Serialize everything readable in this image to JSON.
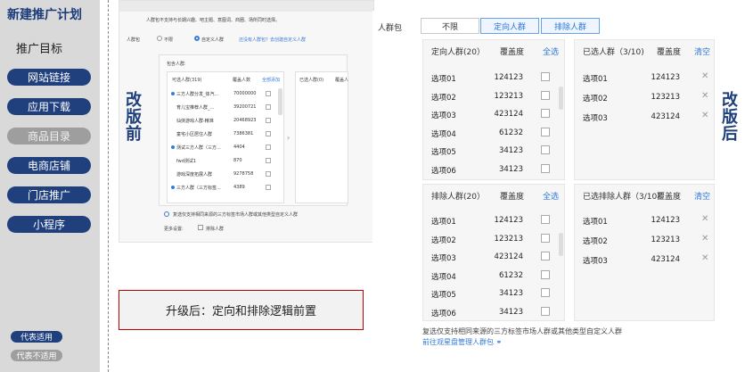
{
  "sidebar": {
    "title": "新建推广计划",
    "subtitle": "推广目标",
    "items": [
      {
        "label": "网站链接",
        "state": "active"
      },
      {
        "label": "应用下载",
        "state": "active"
      },
      {
        "label": "商品目录",
        "state": "disabled"
      },
      {
        "label": "电商店铺",
        "state": "active"
      },
      {
        "label": "门店推广",
        "state": "active"
      },
      {
        "label": "小程序",
        "state": "active"
      }
    ],
    "legend": {
      "applies": "代表适用",
      "not_applies": "代表不适用"
    }
  },
  "labels": {
    "before": "改版前",
    "after": "改版后"
  },
  "upgrade_note": "升级后：定向和排除逻辑前置",
  "before": {
    "notice": "人群包不支持与长期兴趣、吧主题、意图词、商圈、场所同时选择。",
    "field_label": "人群包",
    "radio_unlimited": "不限",
    "radio_custom": "自定义人群",
    "link_text": "还没有人群包？去创建自定义人群",
    "include_label": "包含人群:",
    "available_header": "可选人群(319)",
    "coverage_header": "覆盖人数",
    "add_all": "全部添加",
    "selected_header": "已选人群(0)",
    "selected_coverage": "覆盖人",
    "rows": [
      {
        "name": "三方人群分发_体汽...",
        "value": "70000000"
      },
      {
        "name": "育儿宝推荐人群_...",
        "value": "39200721"
      },
      {
        "name": "仙侠游戏人群-精准",
        "value": "20468923"
      },
      {
        "name": "童宅小区居住人群",
        "value": "7386381"
      },
      {
        "name": "测试三方人群（三方...",
        "value": "4404"
      },
      {
        "name": "fwd测试1",
        "value": "870"
      },
      {
        "name": "游戏深度拓展人群",
        "value": "9278758"
      },
      {
        "name": "三方人群（三方标签...",
        "value": "4389"
      }
    ],
    "bottom_note": "复选仅支持相同来源的三方标签市场人群或其他类型自定义人群",
    "more_settings": "更多设置:",
    "exclude_check": "排除人群"
  },
  "after": {
    "field_label": "人群包",
    "tabs": [
      {
        "label": "不限",
        "selected": false
      },
      {
        "label": "定向人群",
        "selected": true
      },
      {
        "label": "排除人群",
        "selected": true
      }
    ],
    "include_panel": {
      "title": "定向人群(20）",
      "coverage": "覆盖度",
      "action": "全选",
      "rows": [
        {
          "name": "选项01",
          "value": "124123"
        },
        {
          "name": "选项02",
          "value": "123213"
        },
        {
          "name": "选项03",
          "value": "423124"
        },
        {
          "name": "选项04",
          "value": "61232"
        },
        {
          "name": "选项05",
          "value": "34123"
        },
        {
          "name": "选项06",
          "value": "34123"
        }
      ]
    },
    "selected_panel": {
      "title": "已选人群（3/10)",
      "coverage": "覆盖度",
      "action": "清空",
      "rows": [
        {
          "name": "选项01",
          "value": "124123"
        },
        {
          "name": "选项02",
          "value": "123213"
        },
        {
          "name": "选项03",
          "value": "423124"
        }
      ]
    },
    "exclude_panel": {
      "title": "排除人群(20）",
      "coverage": "覆盖度",
      "action": "全选",
      "rows": [
        {
          "name": "选项01",
          "value": "124123"
        },
        {
          "name": "选项02",
          "value": "123213"
        },
        {
          "name": "选项03",
          "value": "423124"
        },
        {
          "name": "选项04",
          "value": "61232"
        },
        {
          "name": "选项05",
          "value": "34123"
        },
        {
          "name": "选项06",
          "value": "34123"
        }
      ]
    },
    "excluded_selected_panel": {
      "title": "已选排除人群（3/10)",
      "coverage": "覆盖度",
      "action": "清空",
      "rows": [
        {
          "name": "选项01",
          "value": "124123"
        },
        {
          "name": "选项02",
          "value": "123213"
        },
        {
          "name": "选项03",
          "value": "423124"
        }
      ]
    },
    "note": "复选仅支持相同来源的三方标签市场人群或其他类型自定义人群",
    "link": "前往观星盘管理人群包"
  },
  "colors": {
    "brand": "#1f3f7d",
    "accent": "#2f78d8",
    "disabled": "#9e9e9e",
    "highlight_border": "#c00000"
  }
}
